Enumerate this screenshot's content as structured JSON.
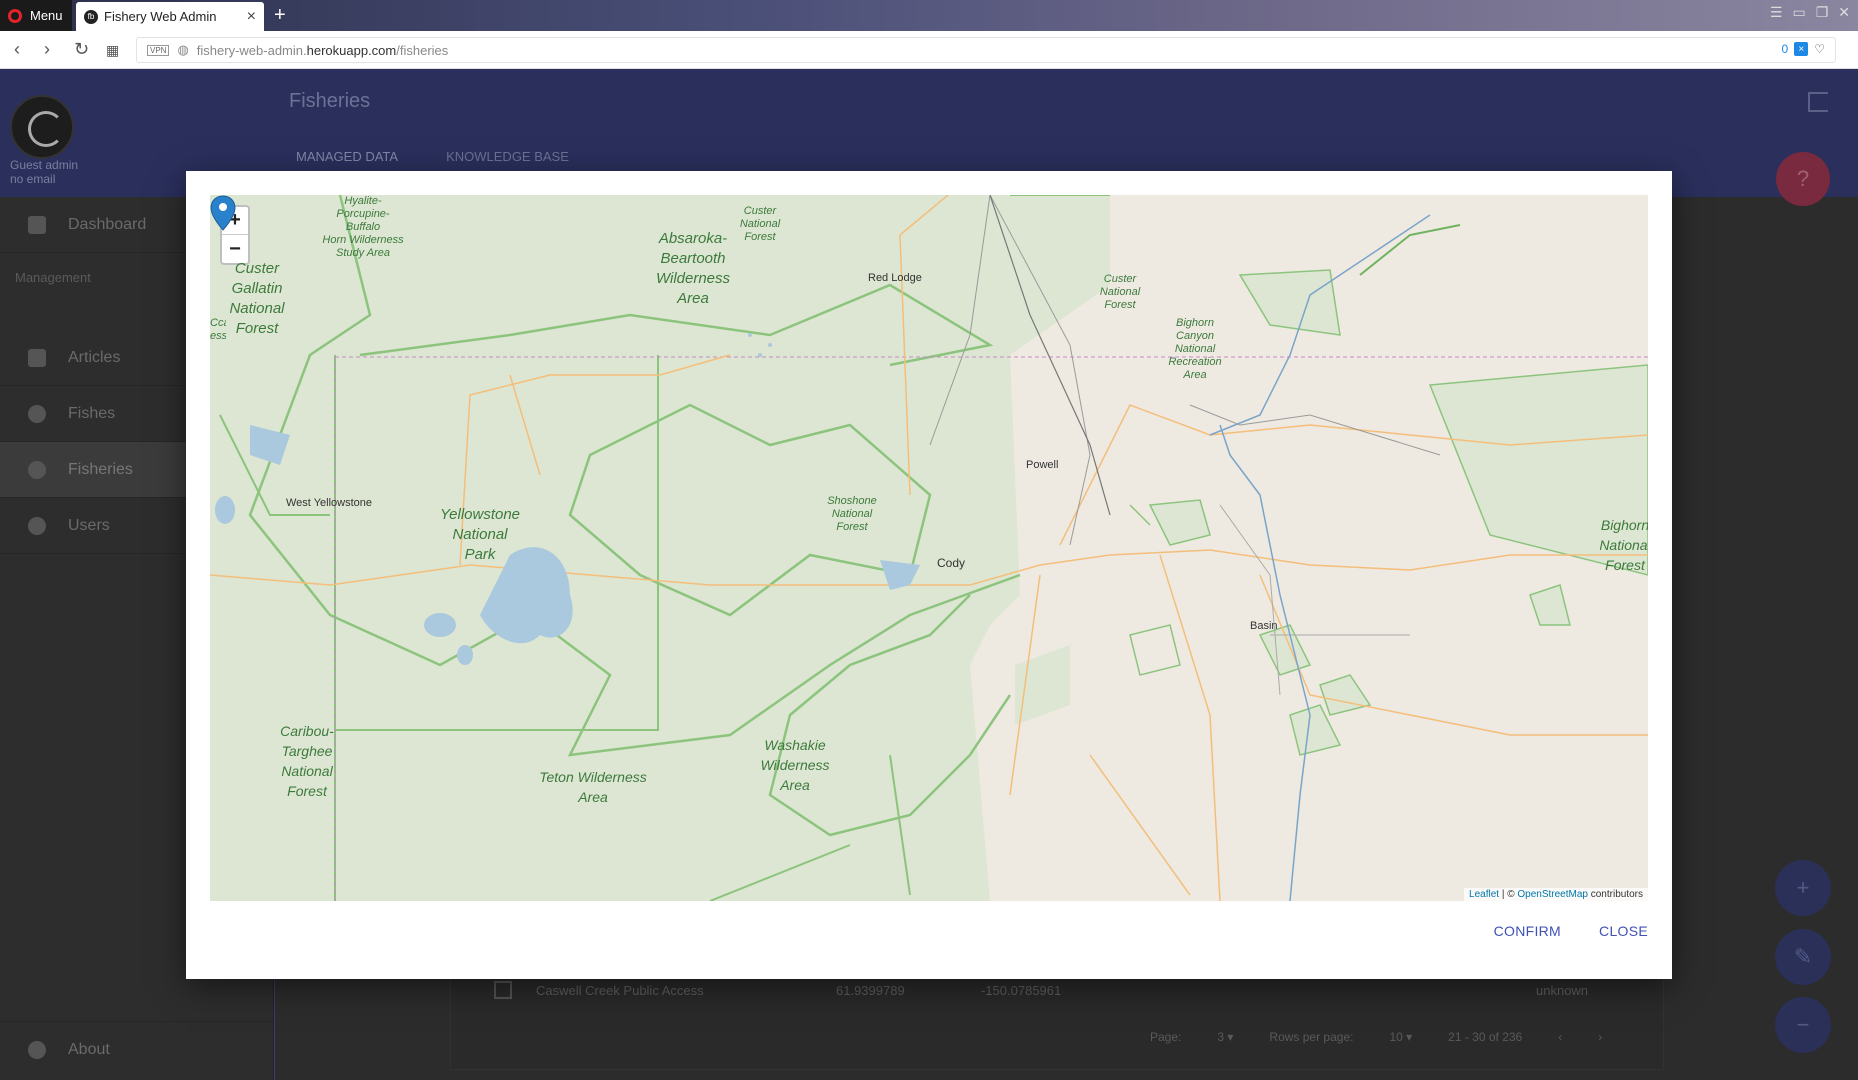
{
  "browser": {
    "menu_label": "Menu",
    "tab_title": "Fishery Web Admin",
    "url_prefix": "fishery-web-admin.",
    "url_host": "herokuapp.com",
    "url_path": "/fisheries",
    "vpn_label": "VPN",
    "ad_count": "0"
  },
  "app": {
    "page_title": "Fisheries",
    "tabs": [
      {
        "label": "MANAGED DATA"
      },
      {
        "label": "KNOWLEDGE BASE"
      }
    ],
    "user_name": "Guest admin",
    "user_email": "no email"
  },
  "sidebar": {
    "dashboard": "Dashboard",
    "section": "Management",
    "items": [
      {
        "label": "Articles"
      },
      {
        "label": "Fishes"
      },
      {
        "label": "Fisheries"
      },
      {
        "label": "Users"
      }
    ],
    "about": "About"
  },
  "table": {
    "row": {
      "name": "Caswell Creek Public Access",
      "lat": "61.9399789",
      "lng": "-150.0785961",
      "status": "unknown"
    },
    "pager": {
      "page_label": "Page:",
      "page": "3",
      "rows_label": "Rows per page:",
      "rows": "10",
      "range": "21 - 30 of 236"
    }
  },
  "modal": {
    "confirm": "CONFIRM",
    "close": "CLOSE",
    "zoom_in": "+",
    "zoom_out": "−",
    "attribution_leaflet": "Leaflet",
    "attribution_sep": " | © ",
    "attribution_osm": "OpenStreetMap",
    "attribution_tail": " contributors"
  },
  "map": {
    "places": [
      "Red Lodge",
      "Powell",
      "West Yellowstone",
      "Cody",
      "Basin"
    ],
    "parks": {
      "hyalite": "Hyalite-\nPorcupine-\nBuffalo\nHorn Wilderness\nStudy Area",
      "custer_top": "Custer\nNational\nForest",
      "absaroka": "Absaroka-\nBeartooth\nWilderness\nArea",
      "custer_gallatin": "Custer\nGallatin\nNational\nForest",
      "custer_right": "Custer\nNational\nForest",
      "bighorn_canyon": "Bighorn\nCanyon\nNational\nRecreation\nArea",
      "yellowstone": "Yellowstone\nNational\nPark",
      "shoshone": "Shoshone\nNational\nForest",
      "bighorn": "Bighorn\nNational\nForest",
      "caribou": "Caribou-\nTarghee\nNational\nForest",
      "teton": "Teton Wilderness\nArea",
      "washakie": "Washakie\nWilderness\nArea",
      "cut_left": "Ccal\ness"
    }
  },
  "colors": {
    "accent": "#3f51b5",
    "header": "#2a2f5c",
    "marker": "#2a81cb"
  }
}
